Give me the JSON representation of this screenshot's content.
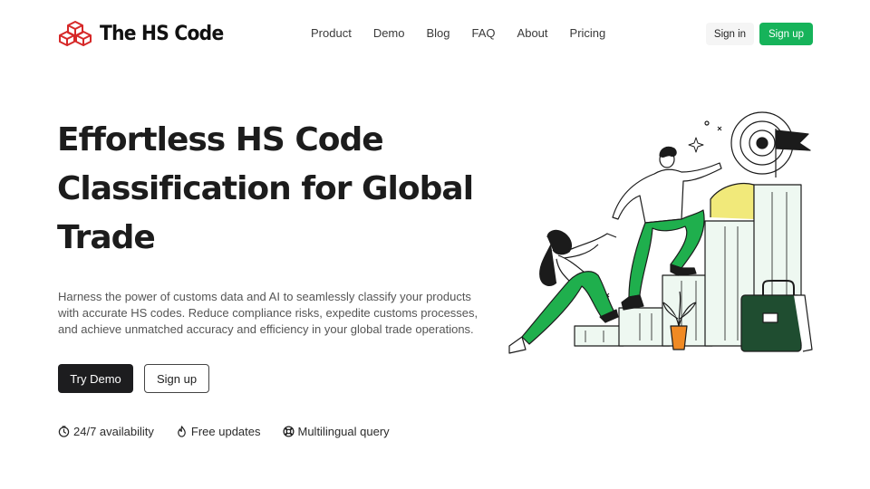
{
  "brand": {
    "name": "The HS Code",
    "logo_color": "#d62828"
  },
  "nav": {
    "items": [
      {
        "label": "Product"
      },
      {
        "label": "Demo"
      },
      {
        "label": "Blog"
      },
      {
        "label": "FAQ"
      },
      {
        "label": "About"
      },
      {
        "label": "Pricing"
      }
    ]
  },
  "header": {
    "signin_label": "Sign in",
    "signup_label": "Sign up",
    "accent_color": "#16b35a"
  },
  "hero": {
    "title": "Effortless HS Code Classification for Global Trade",
    "description": "Harness the power of customs data and AI to seamlessly classify your products with accurate HS codes. Reduce compliance risks, expedite customs processes, and achieve unmatched accuracy and efficiency in your global trade operations.",
    "primary_cta": "Try Demo",
    "secondary_cta": "Sign up"
  },
  "features": [
    {
      "icon": "clock-icon",
      "label": "24/7 availability"
    },
    {
      "icon": "flame-icon",
      "label": "Free updates"
    },
    {
      "icon": "lifebuoy-icon",
      "label": "Multilingual query"
    }
  ]
}
